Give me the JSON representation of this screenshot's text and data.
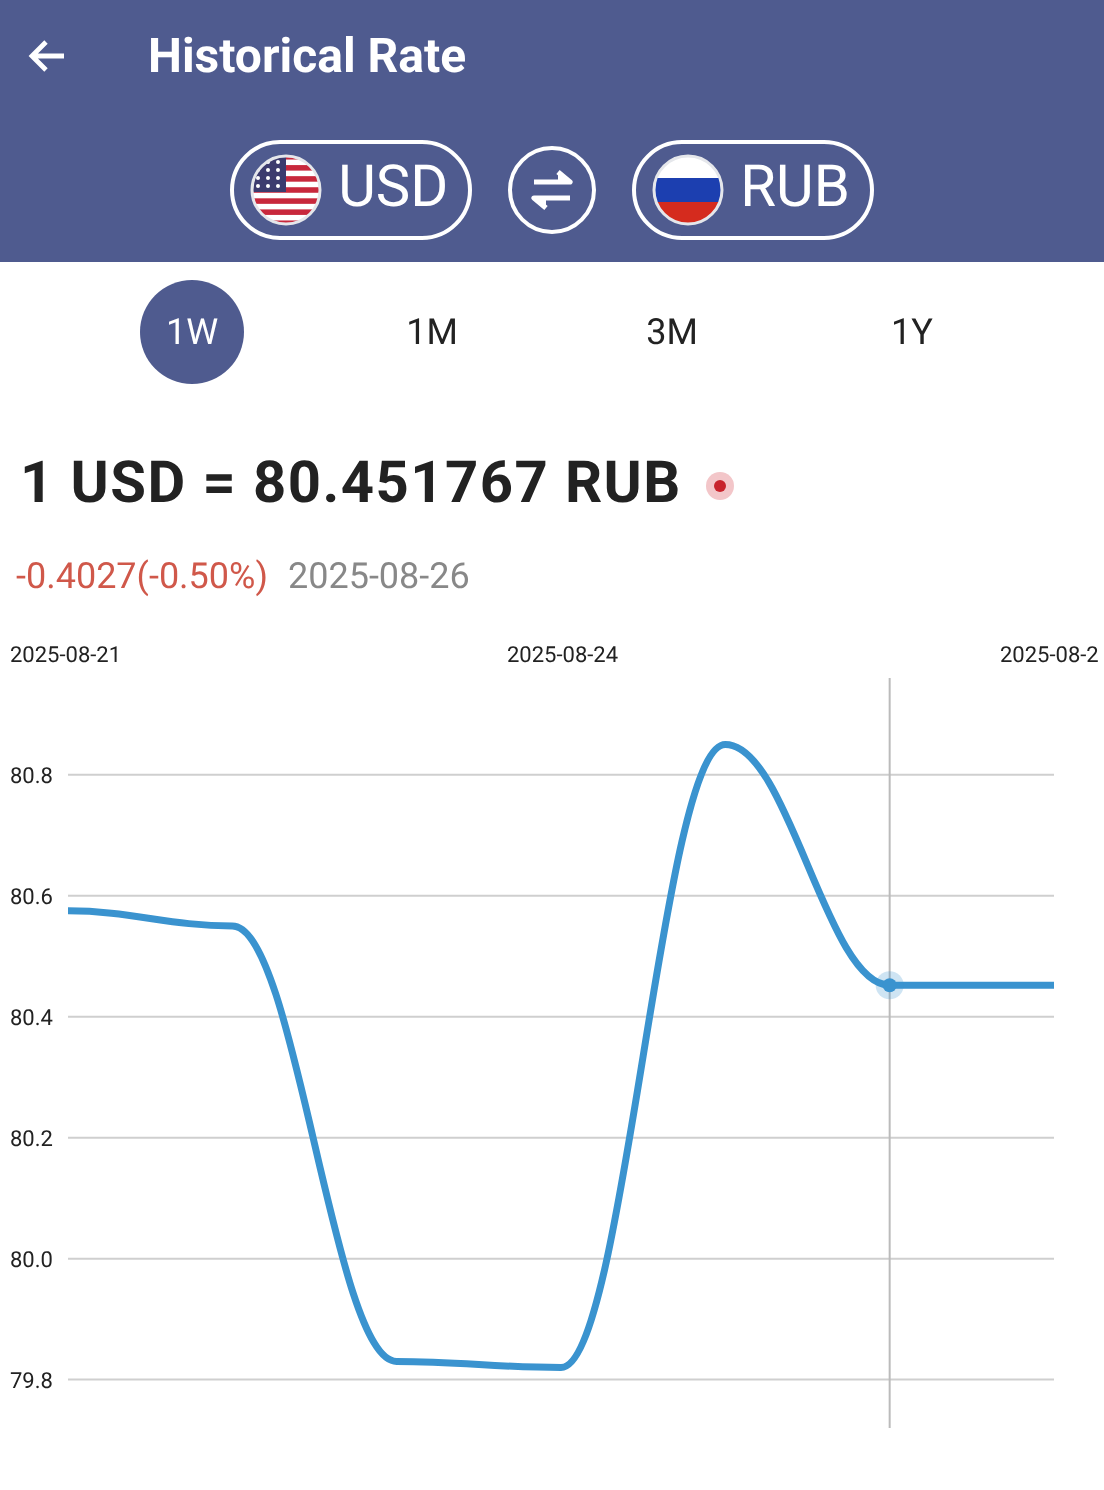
{
  "header": {
    "title": "Historical Rate"
  },
  "currency_pair": {
    "from": {
      "code": "USD"
    },
    "to": {
      "code": "RUB"
    }
  },
  "periods": [
    {
      "label": "1W",
      "selected": true
    },
    {
      "label": "1M",
      "selected": false
    },
    {
      "label": "3M",
      "selected": false
    },
    {
      "label": "1Y",
      "selected": false
    }
  ],
  "rate": {
    "text": "1 USD = 80.451767 RUB",
    "live": true,
    "change": "-0.4027(-0.50%)",
    "date": "2025-08-26"
  },
  "chart_data": {
    "type": "line",
    "categories": [
      "2025-08-21",
      null,
      null,
      "2025-08-24",
      null,
      null,
      "2025-08-2"
    ],
    "ylim": [
      79.72,
      80.96
    ],
    "grid": true,
    "yticks": [
      {
        "value": 79.8,
        "label": "79.8"
      },
      {
        "value": 80.0,
        "label": "80.0"
      },
      {
        "value": 80.2,
        "label": "80.2"
      },
      {
        "value": 80.4,
        "label": "80.4"
      },
      {
        "value": 80.6,
        "label": "80.6"
      },
      {
        "value": 80.8,
        "label": "80.8"
      }
    ],
    "series": [
      {
        "color": "#3a93cf",
        "values": [
          80.575,
          80.55,
          79.83,
          79.82,
          80.85,
          80.452,
          80.452
        ]
      }
    ]
  }
}
